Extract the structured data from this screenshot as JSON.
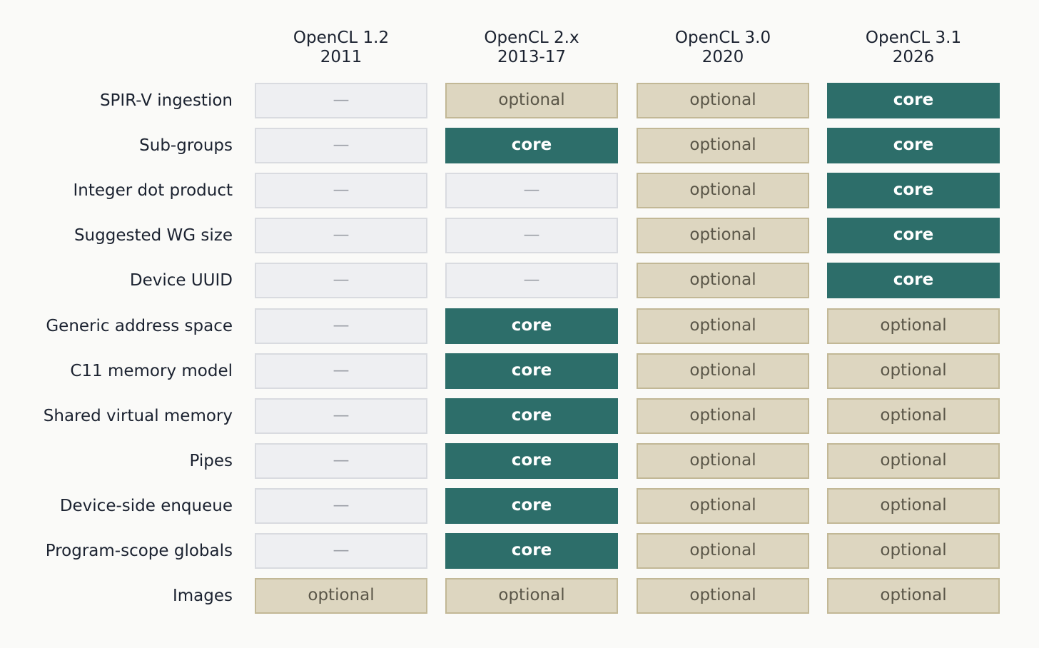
{
  "chart_data": {
    "type": "table",
    "columns": [
      {
        "name": "OpenCL 1.2",
        "year": "2011"
      },
      {
        "name": "OpenCL 2.x",
        "year": "2013-17"
      },
      {
        "name": "OpenCL 3.0",
        "year": "2020"
      },
      {
        "name": "OpenCL 3.1",
        "year": "2026"
      }
    ],
    "rows": [
      {
        "feature": "SPIR-V ingestion",
        "values": [
          "none",
          "optional",
          "optional",
          "core"
        ]
      },
      {
        "feature": "Sub-groups",
        "values": [
          "none",
          "core",
          "optional",
          "core"
        ]
      },
      {
        "feature": "Integer dot product",
        "values": [
          "none",
          "none",
          "optional",
          "core"
        ]
      },
      {
        "feature": "Suggested WG size",
        "values": [
          "none",
          "none",
          "optional",
          "core"
        ]
      },
      {
        "feature": "Device UUID",
        "values": [
          "none",
          "none",
          "optional",
          "core"
        ]
      },
      {
        "feature": "Generic address space",
        "values": [
          "none",
          "core",
          "optional",
          "optional"
        ]
      },
      {
        "feature": "C11 memory model",
        "values": [
          "none",
          "core",
          "optional",
          "optional"
        ]
      },
      {
        "feature": "Shared virtual memory",
        "values": [
          "none",
          "core",
          "optional",
          "optional"
        ]
      },
      {
        "feature": "Pipes",
        "values": [
          "none",
          "core",
          "optional",
          "optional"
        ]
      },
      {
        "feature": "Device-side enqueue",
        "values": [
          "none",
          "core",
          "optional",
          "optional"
        ]
      },
      {
        "feature": "Program-scope globals",
        "values": [
          "none",
          "core",
          "optional",
          "optional"
        ]
      },
      {
        "feature": "Images",
        "values": [
          "optional",
          "optional",
          "optional",
          "optional"
        ]
      }
    ],
    "cell_labels": {
      "none": "—",
      "optional": "optional",
      "core": "core"
    },
    "colors": {
      "core_fill": "#2d6e6a",
      "optional_fill": "#ddd6c0",
      "optional_border": "#c2b896",
      "none_fill": "#eeeff2",
      "none_border": "#d9dbe0",
      "background": "#fafaf8",
      "text": "#1b2230"
    }
  }
}
